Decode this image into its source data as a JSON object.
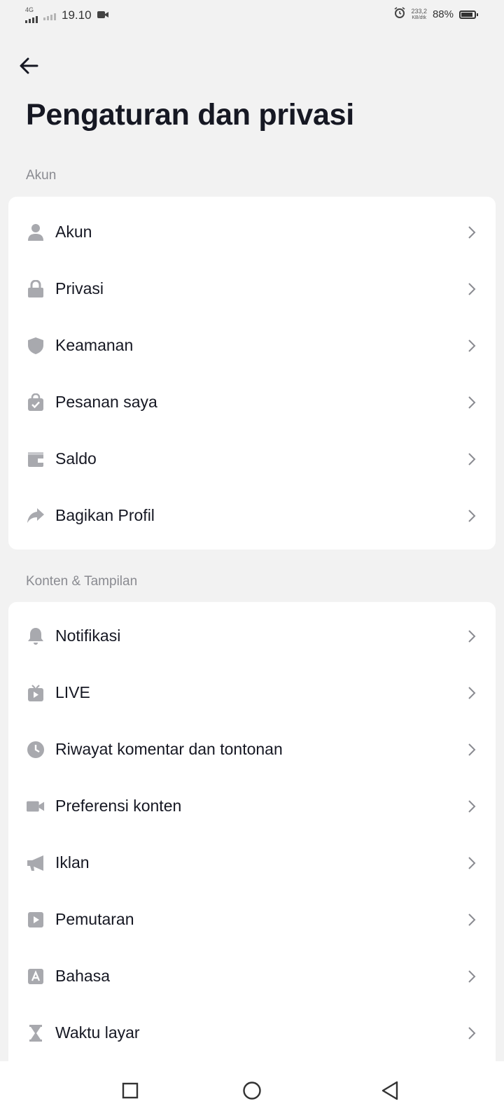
{
  "status_bar": {
    "network": "4G",
    "time": "19.10",
    "speed_value": "233,2",
    "speed_unit": "KB/dtk",
    "battery": "88%",
    "battery_level": 0.88
  },
  "header": {
    "title": "Pengaturan dan privasi"
  },
  "sections": [
    {
      "title": "Akun",
      "items": [
        {
          "label": "Akun",
          "icon": "person-icon"
        },
        {
          "label": "Privasi",
          "icon": "lock-icon"
        },
        {
          "label": "Keamanan",
          "icon": "shield-icon"
        },
        {
          "label": "Pesanan saya",
          "icon": "shopping-bag-icon"
        },
        {
          "label": "Saldo",
          "icon": "wallet-icon"
        },
        {
          "label": "Bagikan Profil",
          "icon": "share-icon"
        }
      ]
    },
    {
      "title": "Konten & Tampilan",
      "items": [
        {
          "label": "Notifikasi",
          "icon": "bell-icon"
        },
        {
          "label": "LIVE",
          "icon": "tv-icon"
        },
        {
          "label": "Riwayat komentar dan tontonan",
          "icon": "clock-icon"
        },
        {
          "label": "Preferensi konten",
          "icon": "video-camera-icon"
        },
        {
          "label": "Iklan",
          "icon": "megaphone-icon"
        },
        {
          "label": "Pemutaran",
          "icon": "play-icon"
        },
        {
          "label": "Bahasa",
          "icon": "language-icon"
        },
        {
          "label": "Waktu layar",
          "icon": "hourglass-icon"
        }
      ]
    }
  ],
  "colors": {
    "background": "#f2f2f2",
    "card": "#ffffff",
    "text": "#161823",
    "secondary_text": "#8a8b91",
    "icon": "#a8a9ae"
  }
}
